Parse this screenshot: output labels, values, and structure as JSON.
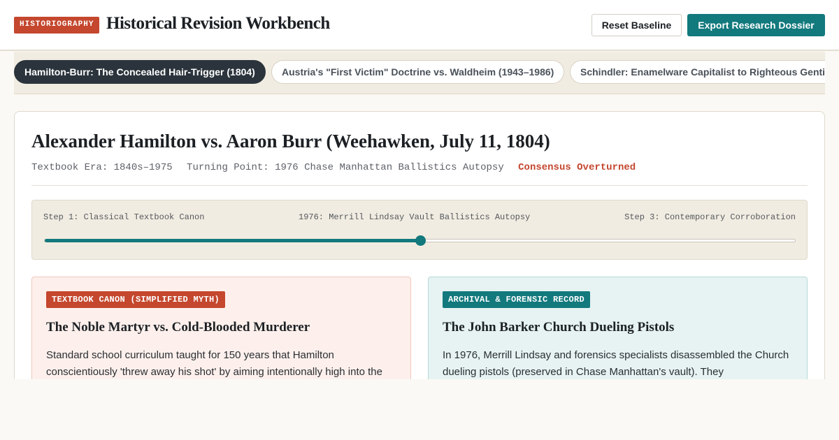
{
  "header": {
    "badge": "HISTORIOGRAPHY",
    "title": "Historical Revision Workbench",
    "reset_label": "Reset Baseline",
    "export_label": "Export Research Dossier"
  },
  "tabs": [
    {
      "label": "Hamilton-Burr: The Concealed Hair-Trigger (1804)",
      "active": true
    },
    {
      "label": "Austria's \"First Victim\" Doctrine vs. Waldheim (1943–1986)",
      "active": false
    },
    {
      "label": "Schindler: Enamelware Capitalist to Righteous Gentile",
      "active": false
    }
  ],
  "case": {
    "title": "Alexander Hamilton vs. Aaron Burr (Weehawken, July 11, 1804)",
    "textbook_era": "Textbook Era: 1840s–1975",
    "turning_point": "Turning Point: 1976 Chase Manhattan Ballistics Autopsy",
    "status": "Consensus Overturned"
  },
  "timeline": {
    "step1": "Step 1: Classical Textbook Canon",
    "step2": "1976: Merrill Lindsay Vault Ballistics Autopsy",
    "step3": "Step 3: Contemporary Corroboration",
    "progress": 0.5
  },
  "panels": {
    "myth": {
      "tag": "TEXTBOOK CANON (SIMPLIFIED MYTH)",
      "title": "The Noble Martyr vs. Cold-Blooded Murderer",
      "body": "Standard school curriculum taught for 150 years that Hamilton conscientiously 'threw away his shot' by aiming intentionally high into the"
    },
    "record": {
      "tag": "ARCHIVAL & FORENSIC RECORD",
      "title": "The John Barker Church Dueling Pistols",
      "body": "In 1976, Merrill Lindsay and forensics specialists disassembled the Church dueling pistols (preserved in Chase Manhattan's vault). They"
    }
  },
  "colors": {
    "accent_red": "#c4472e",
    "accent_teal": "#12797d",
    "dark": "#2b343c"
  }
}
